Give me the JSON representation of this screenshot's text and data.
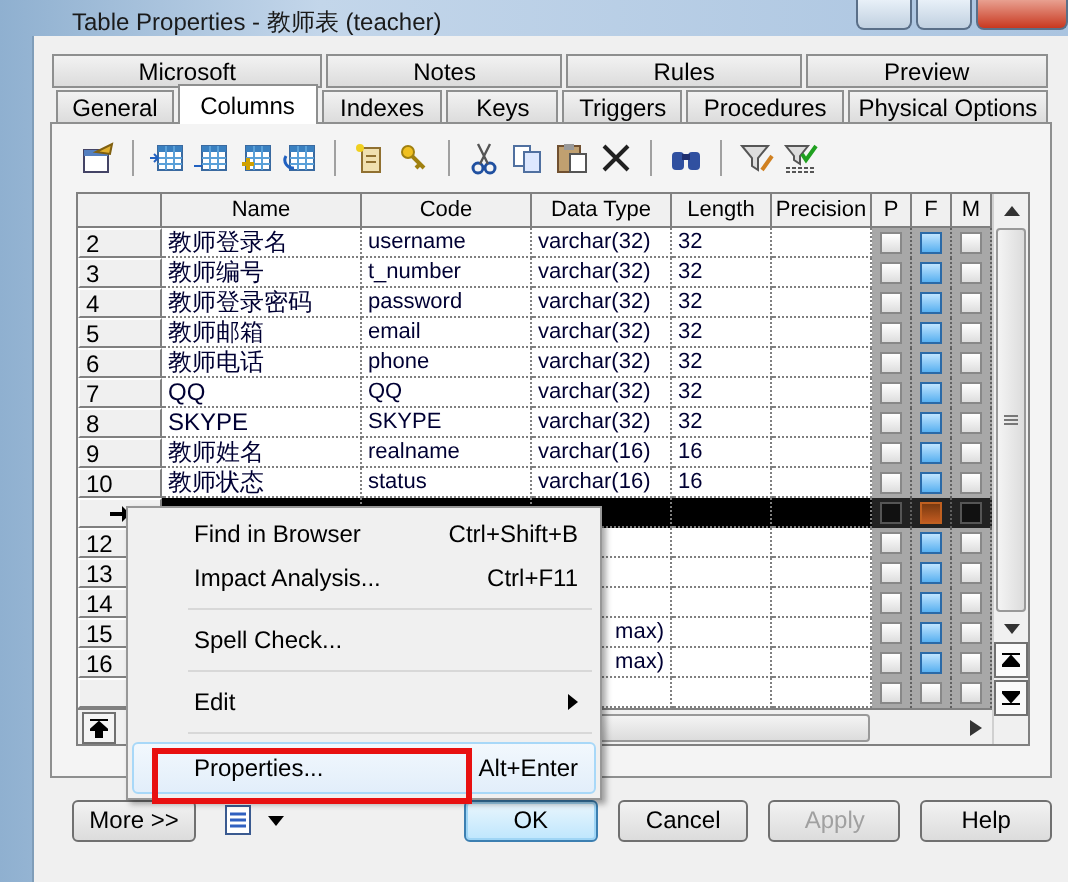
{
  "window": {
    "title": "Table Properties - 教师表 (teacher)"
  },
  "tab_rows": [
    {
      "tabs": [
        {
          "label": "Microsoft",
          "selected": false
        },
        {
          "label": "Notes",
          "selected": false
        },
        {
          "label": "Rules",
          "selected": false
        },
        {
          "label": "Preview",
          "selected": false
        }
      ]
    },
    {
      "tabs": [
        {
          "label": "General",
          "selected": false
        },
        {
          "label": "Columns",
          "selected": true
        },
        {
          "label": "Indexes",
          "selected": false
        },
        {
          "label": "Keys",
          "selected": false
        },
        {
          "label": "Triggers",
          "selected": false
        },
        {
          "label": "Procedures",
          "selected": false
        },
        {
          "label": "Physical Options",
          "selected": false
        }
      ]
    }
  ],
  "grid": {
    "columns": [
      "Name",
      "Code",
      "Data Type",
      "Length",
      "Precision",
      "P",
      "F",
      "M"
    ],
    "rows": [
      {
        "number": "2",
        "name": "教师登录名",
        "code": "username",
        "data_type": "varchar(32)",
        "length": "32",
        "p": false,
        "f": true,
        "m": false,
        "selected": false
      },
      {
        "number": "3",
        "name": "教师编号",
        "code": "t_number",
        "data_type": "varchar(32)",
        "length": "32",
        "p": false,
        "f": true,
        "m": false,
        "selected": false
      },
      {
        "number": "4",
        "name": "教师登录密码",
        "code": "password",
        "data_type": "varchar(32)",
        "length": "32",
        "p": false,
        "f": true,
        "m": false,
        "selected": false
      },
      {
        "number": "5",
        "name": "教师邮箱",
        "code": "email",
        "data_type": "varchar(32)",
        "length": "32",
        "p": false,
        "f": true,
        "m": false,
        "selected": false
      },
      {
        "number": "6",
        "name": "教师电话",
        "code": "phone",
        "data_type": "varchar(32)",
        "length": "32",
        "p": false,
        "f": true,
        "m": false,
        "selected": false
      },
      {
        "number": "7",
        "name": "QQ",
        "code": "QQ",
        "data_type": "varchar(32)",
        "length": "32",
        "p": false,
        "f": true,
        "m": false,
        "selected": false
      },
      {
        "number": "8",
        "name": "SKYPE",
        "code": "SKYPE",
        "data_type": "varchar(32)",
        "length": "32",
        "p": false,
        "f": true,
        "m": false,
        "selected": false
      },
      {
        "number": "9",
        "name": "教师姓名",
        "code": "realname",
        "data_type": "varchar(16)",
        "length": "16",
        "p": false,
        "f": true,
        "m": false,
        "selected": false
      },
      {
        "number": "10",
        "name": "教师状态",
        "code": "status",
        "data_type": "varchar(16)",
        "length": "16",
        "p": false,
        "f": true,
        "m": false,
        "selected": false
      },
      {
        "current": true,
        "p": false,
        "f": true,
        "m": false,
        "selected": true
      },
      {
        "number": "12",
        "p": false,
        "f": true,
        "m": false,
        "selected": false
      },
      {
        "number": "13",
        "p": false,
        "f": true,
        "m": false,
        "selected": false
      },
      {
        "number": "14",
        "p": false,
        "f": true,
        "m": false,
        "selected": false
      },
      {
        "number": "15",
        "data_type": "max)",
        "p": false,
        "f": true,
        "m": false,
        "selected": false
      },
      {
        "number": "16",
        "data_type": "max)",
        "p": false,
        "f": true,
        "m": false,
        "selected": false
      },
      {
        "p": false,
        "f": false,
        "m": false,
        "selected": false
      }
    ]
  },
  "context_menu": {
    "items": [
      {
        "kind": "item",
        "label": "Find in Browser",
        "shortcut": "Ctrl+Shift+B",
        "highlighted": false
      },
      {
        "kind": "item",
        "label": "Impact Analysis...",
        "shortcut": "Ctrl+F11",
        "highlighted": false
      },
      {
        "kind": "separator"
      },
      {
        "kind": "item",
        "label": "Spell Check...",
        "highlighted": false
      },
      {
        "kind": "separator"
      },
      {
        "kind": "submenu",
        "label": "Edit",
        "highlighted": false
      },
      {
        "kind": "separator"
      },
      {
        "kind": "item",
        "label": "Properties...",
        "shortcut": "Alt+Enter",
        "highlighted": true,
        "annotated": true
      }
    ]
  },
  "buttons": [
    {
      "label": "More >>",
      "default": false,
      "disabled": false
    },
    {
      "label": "OK",
      "default": true,
      "disabled": false
    },
    {
      "label": "Cancel",
      "default": false,
      "disabled": false
    },
    {
      "label": "Apply",
      "default": false,
      "disabled": true
    },
    {
      "label": "Help",
      "default": false,
      "disabled": false
    }
  ]
}
